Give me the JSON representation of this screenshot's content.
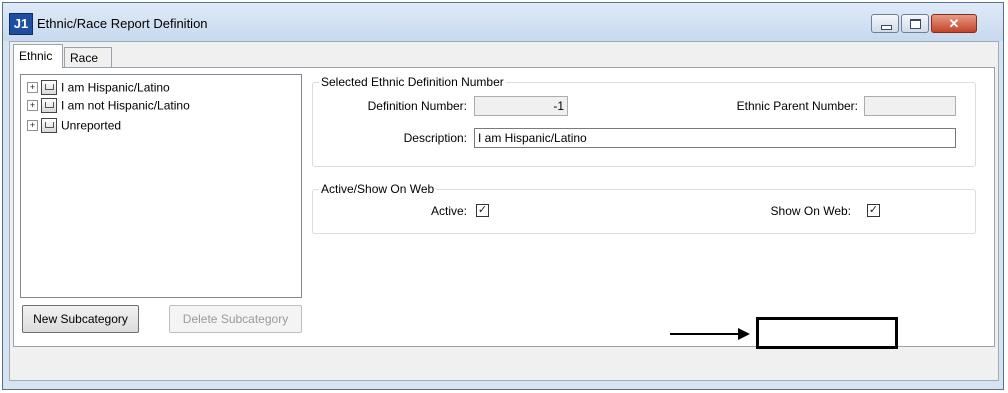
{
  "window": {
    "icon_text": "J1",
    "title": "Ethnic/Race Report Definition",
    "close_symbol": "✕"
  },
  "tabs": [
    {
      "label": "Ethnic",
      "selected": true
    },
    {
      "label": "Race",
      "selected": false
    }
  ],
  "tree": {
    "items": [
      {
        "label": "I am Hispanic/Latino",
        "expander": "+"
      },
      {
        "label": "I am not Hispanic/Latino",
        "expander": "+"
      },
      {
        "label": "Unreported",
        "expander": "+"
      }
    ]
  },
  "buttons": {
    "new_subcategory": "New Subcategory",
    "delete_subcategory": "Delete Subcategory"
  },
  "definition_group": {
    "legend": "Selected Ethnic Definition Number",
    "definition_number_label": "Definition Number:",
    "definition_number_value": "-1",
    "ethnic_parent_label": "Ethnic Parent Number:",
    "ethnic_parent_value": "",
    "description_label": "Description:",
    "description_value": "I am Hispanic/Latino"
  },
  "active_group": {
    "legend": "Active/Show On Web",
    "active_label": "Active:",
    "active_checked": true,
    "show_on_web_label": "Show On Web:",
    "show_on_web_checked": true,
    "check_glyph": "✓"
  }
}
